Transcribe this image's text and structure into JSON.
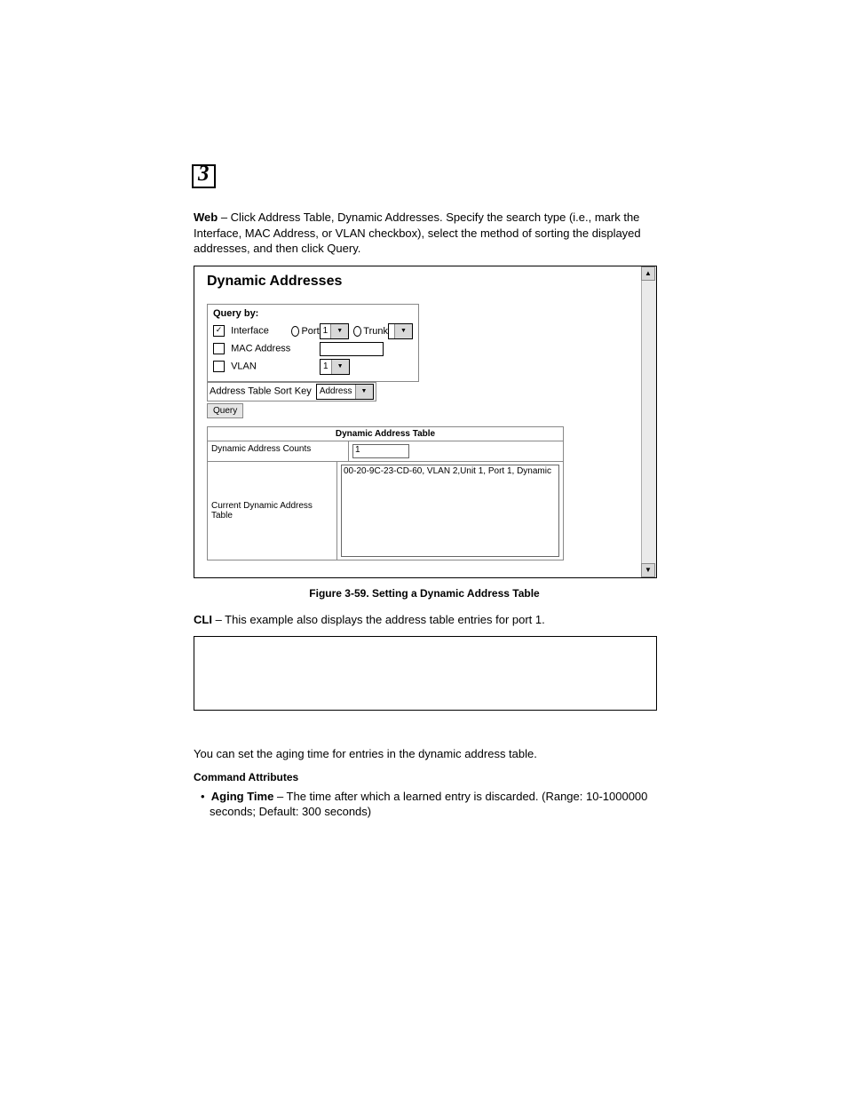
{
  "chapter": "3",
  "intro": {
    "label_web": "Web",
    "text": " – Click Address Table, Dynamic Addresses. Specify the search type (i.e., mark the Interface, MAC Address, or VLAN checkbox), select the method of sorting the displayed addresses, and then click Query."
  },
  "panel": {
    "title": "Dynamic Addresses",
    "query_by": "Query by:",
    "interface": {
      "label": "Interface",
      "checked": true,
      "port_label": "Port",
      "port_val": "1",
      "port_selected": true,
      "trunk_label": "Trunk",
      "trunk_val": "",
      "trunk_selected": false
    },
    "mac": {
      "label": "MAC Address",
      "checked": false,
      "value": ""
    },
    "vlan": {
      "label": "VLAN",
      "checked": false,
      "value": "1"
    },
    "sortkey": {
      "label": "Address Table Sort Key",
      "value": "Address"
    },
    "query_btn": "Query",
    "dat": {
      "heading": "Dynamic Address Table",
      "counts_label": "Dynamic Address Counts",
      "counts_value": "1",
      "current_label": "Current Dynamic Address Table",
      "rows": [
        "00-20-9C-23-CD-60, VLAN 2,Unit 1, Port 1, Dynamic"
      ]
    },
    "scroll_up": "▲",
    "scroll_down": "▼"
  },
  "fig_caption": "Figure 3-59.  Setting a Dynamic Address Table",
  "cli": {
    "label": "CLI",
    "text": " – This example also displays the address table entries for port 1."
  },
  "aging_intro": "You can set the aging time for entries in the dynamic address table.",
  "cmd_attr_heading": "Command Attributes",
  "aging": {
    "label": "Aging Time",
    "text": " – The time after which a learned entry is discarded. (Range: 10-1000000 seconds; Default: 300 seconds)"
  }
}
